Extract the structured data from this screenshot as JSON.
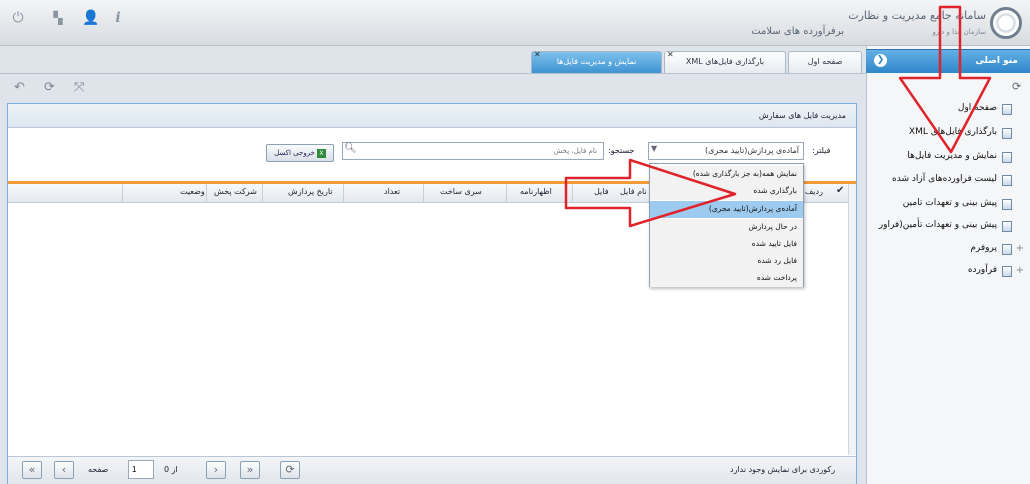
{
  "header": {
    "brand_line1": "سامانه جامع مدیریت و نظارت",
    "brand_line2": "برفرآورده های سلامت",
    "brand_line3": "سازمان غذا و دارو",
    "icons": [
      "power-icon",
      "windows-icon",
      "user-icon",
      "info-icon"
    ]
  },
  "tabs": [
    {
      "label": "صفحه اول",
      "closable": false,
      "active": false
    },
    {
      "label": "بارگذاری فایل‌های XML",
      "closable": true,
      "active": false
    },
    {
      "label": "نمایش و مدیریت فایل‌ها",
      "closable": true,
      "active": true
    }
  ],
  "toolbar": {
    "icons": [
      "undo-icon",
      "refresh-icon",
      "fullscreen-icon"
    ]
  },
  "sidebar": {
    "title": "منو اصلی",
    "items": [
      {
        "label": "صفحه اول",
        "expandable": false
      },
      {
        "label": "بارگذاری فایل‌های XML",
        "expandable": false
      },
      {
        "label": "نمایش و مدیریت فایل‌ها",
        "expandable": false
      },
      {
        "label": "لیست فراورده‌های آزاد شده",
        "expandable": false
      },
      {
        "label": "پیش بینی و تعهدات تامین",
        "expandable": false
      },
      {
        "label": "پیش بینی و تعهدات تأمین(فراور",
        "expandable": false
      },
      {
        "label": "پروفرم",
        "expandable": true
      },
      {
        "label": "فرآورده",
        "expandable": true
      }
    ]
  },
  "panel": {
    "title": "مدیریت فایل های سفارش",
    "filter_label": "فیلتر:",
    "filter_value": "آماده‌ی پردازش(تایید مجری)",
    "search_label": "جستجو:",
    "search_placeholder": "نام فایل، پخش",
    "excel_button": "خروجی اکسل"
  },
  "grid": {
    "columns": [
      "ردیف",
      "نام فایل",
      "فایل",
      "اظهارنامه",
      "سری ساخت",
      "تعداد",
      "تاریخ پردازش",
      "شرکت پخش",
      "وضعیت"
    ]
  },
  "dropdown": {
    "options": [
      {
        "label": "نمایش همه(به جز بارگذاری شده)",
        "selected": false
      },
      {
        "label": "بارگذاری شده",
        "selected": false
      },
      {
        "label": "آماده‌ی پردازش(تایید مجری)",
        "selected": true
      },
      {
        "label": "در حال پردازش",
        "selected": false
      },
      {
        "label": "فایل تایید شده",
        "selected": false
      },
      {
        "label": "فایل رد شده",
        "selected": false
      },
      {
        "label": "پرداخت شده",
        "selected": false
      }
    ]
  },
  "pager": {
    "page_label": "صفحه",
    "page_value": "1",
    "of_label": "از 0",
    "empty_text": "رکوردی برای نمایش وجود ندارد"
  },
  "colors": {
    "accent": "#3e93d1",
    "annotation": "#e0232a",
    "grid_separator": "#f39b37"
  }
}
